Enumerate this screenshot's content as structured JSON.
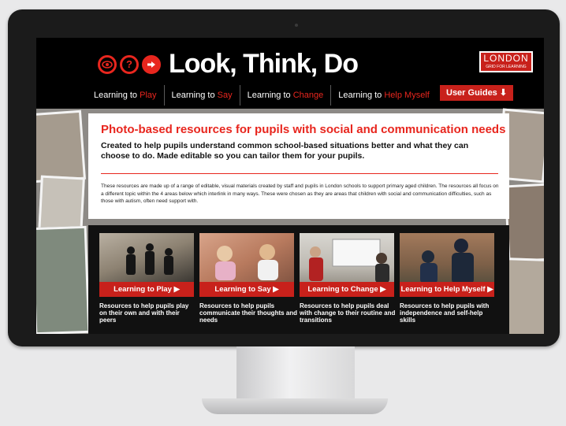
{
  "header": {
    "logo_icons": [
      "eye-icon",
      "question-icon",
      "arrow-right-icon"
    ],
    "question_glyph": "?",
    "title": "Look, Think, Do",
    "partner_logo": {
      "line1": "LONDON",
      "line2": "GRID FOR LEARNING"
    }
  },
  "nav": {
    "items": [
      {
        "prefix": "Learning to ",
        "highlight": "Play"
      },
      {
        "prefix": "Learning to ",
        "highlight": "Say"
      },
      {
        "prefix": "Learning to ",
        "highlight": "Change"
      },
      {
        "prefix": "Learning to ",
        "highlight": "Help Myself"
      }
    ],
    "guides_label": "User Guides ⬇"
  },
  "intro": {
    "heading": "Photo-based resources for pupils with social and communication needs",
    "lead": "Created to help pupils understand common school-based situations better and what they can choose to do. Made editable so you can tailor them for your pupils.",
    "body": "These resources are made up of a range of editable, visual materials created by staff and pupils in London schools to support primary aged children. The resources all focus on a different topic within the 4 areas below which interlink in many ways. These were chosen as they are areas that children with social and communication difficulties, such as those with autism, often need support with."
  },
  "cards": [
    {
      "button": "Learning to Play ▶",
      "desc": "Resources to help pupils play on their own and with their peers"
    },
    {
      "button": "Learning to Say ▶",
      "desc": "Resources to help pupils communicate their thoughts and needs"
    },
    {
      "button": "Learning to Change ▶",
      "desc": "Resources to help pupils deal with change to their routine and transitions"
    },
    {
      "button": "Learning to Help Myself ▶",
      "desc": "Resources to help pupils with independence and self-help skills"
    }
  ],
  "colors": {
    "accent": "#e8261e",
    "button": "#c8211b",
    "header_bg": "#000000"
  }
}
